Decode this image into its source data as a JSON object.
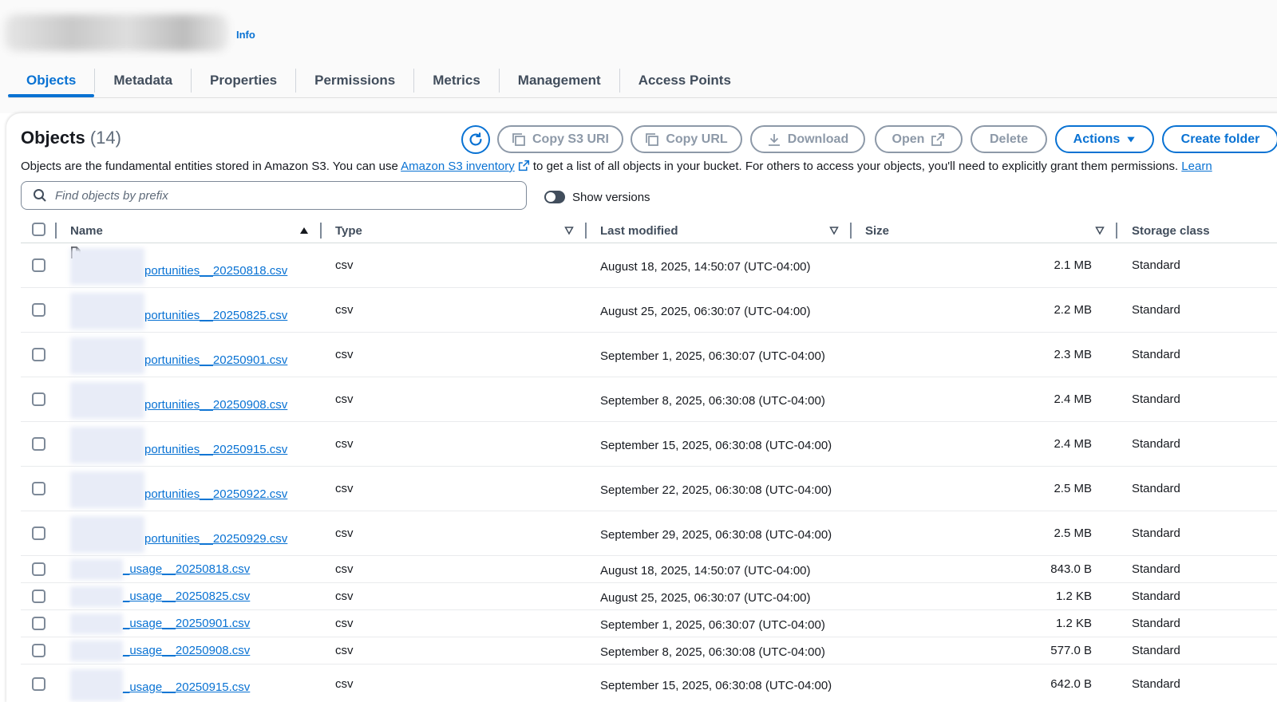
{
  "header": {
    "info_label": "Info"
  },
  "tabs": [
    {
      "label": "Objects",
      "active": true
    },
    {
      "label": "Metadata"
    },
    {
      "label": "Properties"
    },
    {
      "label": "Permissions"
    },
    {
      "label": "Metrics"
    },
    {
      "label": "Management"
    },
    {
      "label": "Access Points"
    }
  ],
  "objects": {
    "title": "Objects",
    "count": "(14)",
    "buttons": {
      "copy_s3_uri": "Copy S3 URI",
      "copy_url": "Copy URL",
      "download": "Download",
      "open": "Open",
      "delete": "Delete",
      "actions": "Actions",
      "create_folder": "Create folder"
    },
    "description": {
      "before": "Objects are the fundamental entities stored in Amazon S3. You can use ",
      "link": "Amazon S3 inventory",
      "after": " to get a list of all objects in your bucket. For others to access your objects, you'll need to explicitly grant them permissions. ",
      "learn": "Learn"
    },
    "search_placeholder": "Find objects by prefix",
    "show_versions": "Show versions"
  },
  "table": {
    "headers": {
      "name": "Name",
      "type": "Type",
      "last_modified": "Last modified",
      "size": "Size",
      "storage_class": "Storage class"
    },
    "rows": [
      {
        "name": "portunities__20250818.csv",
        "type": "csv",
        "modified": "August 18, 2025, 14:50:07 (UTC-04:00)",
        "size": "2.1 MB",
        "storage": "Standard"
      },
      {
        "name": "portunities__20250825.csv",
        "type": "csv",
        "modified": "August 25, 2025, 06:30:07 (UTC-04:00)",
        "size": "2.2 MB",
        "storage": "Standard"
      },
      {
        "name": "portunities__20250901.csv",
        "type": "csv",
        "modified": "September 1, 2025, 06:30:07 (UTC-04:00)",
        "size": "2.3 MB",
        "storage": "Standard"
      },
      {
        "name": "portunities__20250908.csv",
        "type": "csv",
        "modified": "September 8, 2025, 06:30:08 (UTC-04:00)",
        "size": "2.4 MB",
        "storage": "Standard"
      },
      {
        "name": "portunities__20250915.csv",
        "type": "csv",
        "modified": "September 15, 2025, 06:30:08 (UTC-04:00)",
        "size": "2.4 MB",
        "storage": "Standard"
      },
      {
        "name": "portunities__20250922.csv",
        "type": "csv",
        "modified": "September 22, 2025, 06:30:08 (UTC-04:00)",
        "size": "2.5 MB",
        "storage": "Standard"
      },
      {
        "name": "portunities__20250929.csv",
        "type": "csv",
        "modified": "September 29, 2025, 06:30:08 (UTC-04:00)",
        "size": "2.5 MB",
        "storage": "Standard"
      },
      {
        "name": "_usage__20250818.csv",
        "type": "csv",
        "modified": "August 18, 2025, 14:50:07 (UTC-04:00)",
        "size": "843.0 B",
        "storage": "Standard"
      },
      {
        "name": "_usage__20250825.csv",
        "type": "csv",
        "modified": "August 25, 2025, 06:30:07 (UTC-04:00)",
        "size": "1.2 KB",
        "storage": "Standard"
      },
      {
        "name": "_usage__20250901.csv",
        "type": "csv",
        "modified": "September 1, 2025, 06:30:07 (UTC-04:00)",
        "size": "1.2 KB",
        "storage": "Standard"
      },
      {
        "name": "_usage__20250908.csv",
        "type": "csv",
        "modified": "September 8, 2025, 06:30:08 (UTC-04:00)",
        "size": "577.0 B",
        "storage": "Standard"
      },
      {
        "name": "_usage__20250915.csv",
        "type": "csv",
        "modified": "September 15, 2025, 06:30:08 (UTC-04:00)",
        "size": "642.0 B",
        "storage": "Standard"
      }
    ]
  }
}
